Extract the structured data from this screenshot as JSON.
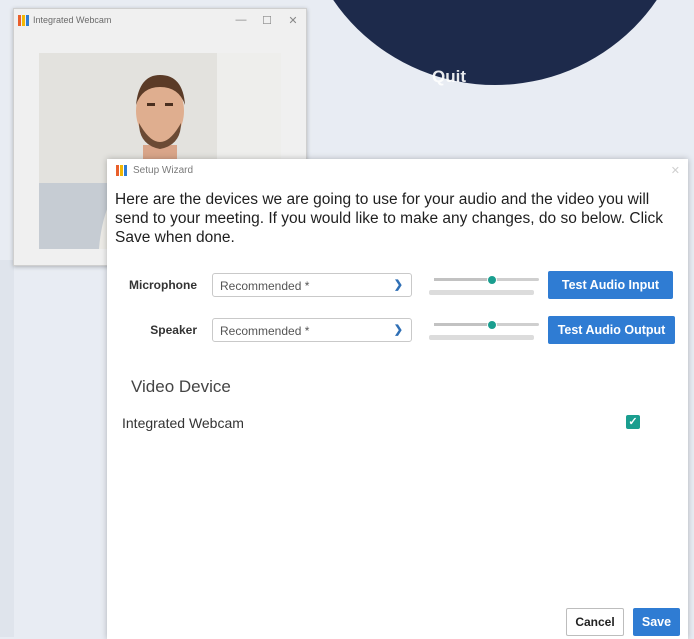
{
  "background": {
    "circle_text": "Quit"
  },
  "webcam_window": {
    "title": "Integrated Webcam",
    "controls": {
      "minimize": "—",
      "maximize": "☐",
      "close": "✕"
    }
  },
  "wizard": {
    "title": "Setup Wizard",
    "close": "✕",
    "intro": "Here are the devices we are going to use for your audio and the video you will send to your meeting. If you would like to make any changes, do so below. Click Save when done.",
    "microphone": {
      "label": "Microphone",
      "value": "Recommended *",
      "volume": 0.55,
      "test_label": "Test Audio Input"
    },
    "speaker": {
      "label": "Speaker",
      "value": "Recommended *",
      "volume": 0.55,
      "test_label": "Test Audio Output"
    },
    "video_section_title": "Video Device",
    "video_device": {
      "name": "Integrated Webcam",
      "checked": true
    },
    "cancel_label": "Cancel",
    "save_label": "Save"
  },
  "colors": {
    "accent": "#2f7cd3",
    "teal": "#1a9e8f",
    "navy": "#1d2a4b"
  },
  "icons": [
    "app-logo-icon",
    "chevron-down-icon",
    "checkmark-icon",
    "close-icon",
    "minimize-icon",
    "maximize-icon"
  ]
}
